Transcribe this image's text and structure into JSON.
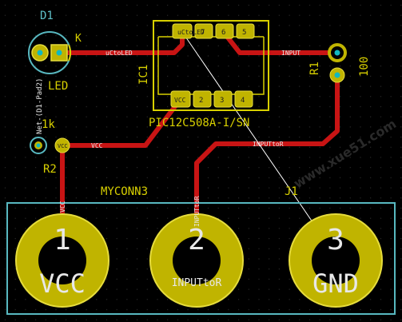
{
  "colors": {
    "background": "#000000",
    "track": "#c81414",
    "pad": "#c0b400",
    "pad_stroke": "#e6dc3c",
    "silkscreen": "#d8d000",
    "courtyard": "#58b8c0",
    "ratsnest": "#ffffff",
    "drill": "#10b8c0"
  },
  "components": {
    "d1": {
      "reference": "D1",
      "value": "LED",
      "cathode_label": "K",
      "icon": "led-footprint-icon"
    },
    "ic1": {
      "reference": "IC1",
      "value": "PIC12C508A-I/SN",
      "pads_top": [
        "5",
        "6",
        "7",
        "8"
      ],
      "pads_bottom": [
        "4",
        "3",
        "2",
        "1"
      ],
      "icon": "soic8-footprint-icon"
    },
    "r1": {
      "reference": "R1",
      "value": "100"
    },
    "r2": {
      "reference": "R2",
      "value": "1k",
      "net_vertical": "Net-(D1-Pad2)"
    },
    "j1": {
      "reference": "J1",
      "value": "MYCONN3",
      "pads": [
        "1",
        "2",
        "3"
      ],
      "pad_nets": [
        "VCC",
        "INPUTtoR",
        "GND"
      ]
    }
  },
  "nets": {
    "uctoled": "uCtoLED",
    "input": "INPUT",
    "inputtor": "INPUTtoR",
    "vcc": "VCC",
    "vcc_vertical": "VCC",
    "inputtor_vertical": "INPUTtoR",
    "ic_pad_vcc": "VCC",
    "ic_pad_input": "INPUT",
    "ic_pad_gnd": "GND",
    "ic_pad_uctoled": "uCtoLED"
  },
  "watermark": "www.xue51.com"
}
